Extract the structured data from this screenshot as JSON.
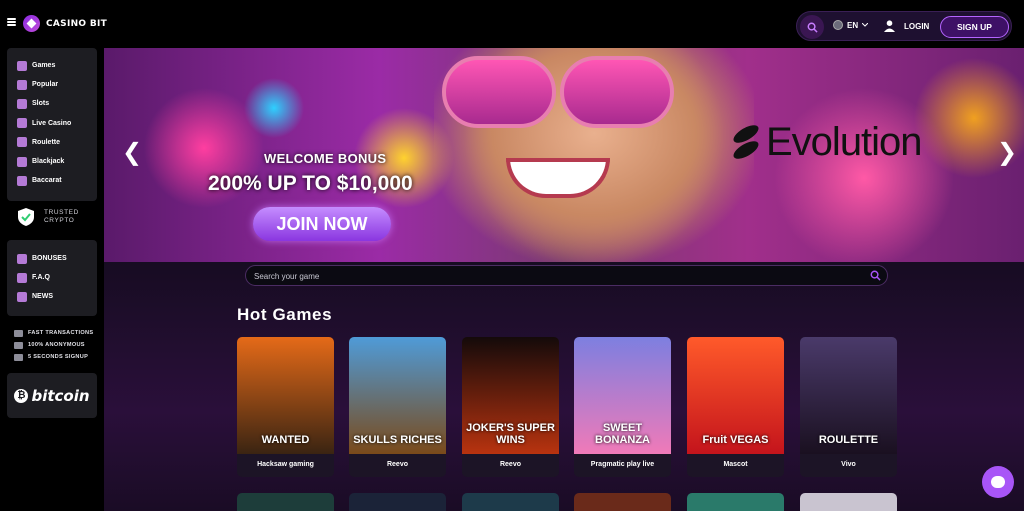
{
  "header": {
    "logo_text": "CASINO BIT",
    "language": "EN",
    "login_label": "LOGIN",
    "signup_label": "SIGN UP"
  },
  "sidebar": {
    "games_items": [
      {
        "label": "Games",
        "icon": "cherries-icon"
      },
      {
        "label": "Popular",
        "icon": "popular-icon"
      },
      {
        "label": "Slots",
        "icon": "slots-icon"
      },
      {
        "label": "Live Casino",
        "icon": "live-casino-icon"
      },
      {
        "label": "Roulette",
        "icon": "roulette-icon"
      },
      {
        "label": "Blackjack",
        "icon": "blackjack-icon"
      },
      {
        "label": "Baccarat",
        "icon": "baccarat-icon"
      }
    ],
    "trusted_line1": "TRUSTED",
    "trusted_line2": "CRYPTO",
    "info_items": [
      {
        "label": "BONUSES",
        "icon": "bonus-icon"
      },
      {
        "label": "F.A.Q",
        "icon": "faq-icon"
      },
      {
        "label": "NEWS",
        "icon": "news-icon"
      }
    ],
    "features": [
      "FAST TRANSACTIONS",
      "100% ANONYMOUS",
      "5 SECONDS SIGNUP"
    ],
    "bitcoin_text": "bitcoin"
  },
  "hero": {
    "welcome": "WELCOME BONUS",
    "bonus": "200% UP TO $10,000",
    "cta": "JOIN NOW",
    "partner": "Evolution"
  },
  "search": {
    "placeholder": "Search your game"
  },
  "hot_games": {
    "title": "Hot Games",
    "cards": [
      {
        "art_text": "WANTED",
        "provider": "Hacksaw gaming",
        "color_top": "#e56a18",
        "color_bottom": "#3a2412"
      },
      {
        "art_text": "SKULLS RICHES",
        "provider": "Reevo",
        "color_top": "#4f9bd8",
        "color_bottom": "#7a4a1a"
      },
      {
        "art_text": "JOKER'S SUPER WINS",
        "provider": "Reevo",
        "color_top": "#140a0a",
        "color_bottom": "#b8330f"
      },
      {
        "art_text": "SWEET BONANZA",
        "provider": "Pragmatic play live",
        "color_top": "#7d7fe0",
        "color_bottom": "#f07ab8"
      },
      {
        "art_text": "Fruit VEGAS",
        "provider": "Mascot",
        "color_top": "#ff5a2a",
        "color_bottom": "#c4141c"
      },
      {
        "art_text": "ROULETTE",
        "provider": "Vivo",
        "color_top": "#4a3a6a",
        "color_bottom": "#1a1020"
      }
    ]
  }
}
